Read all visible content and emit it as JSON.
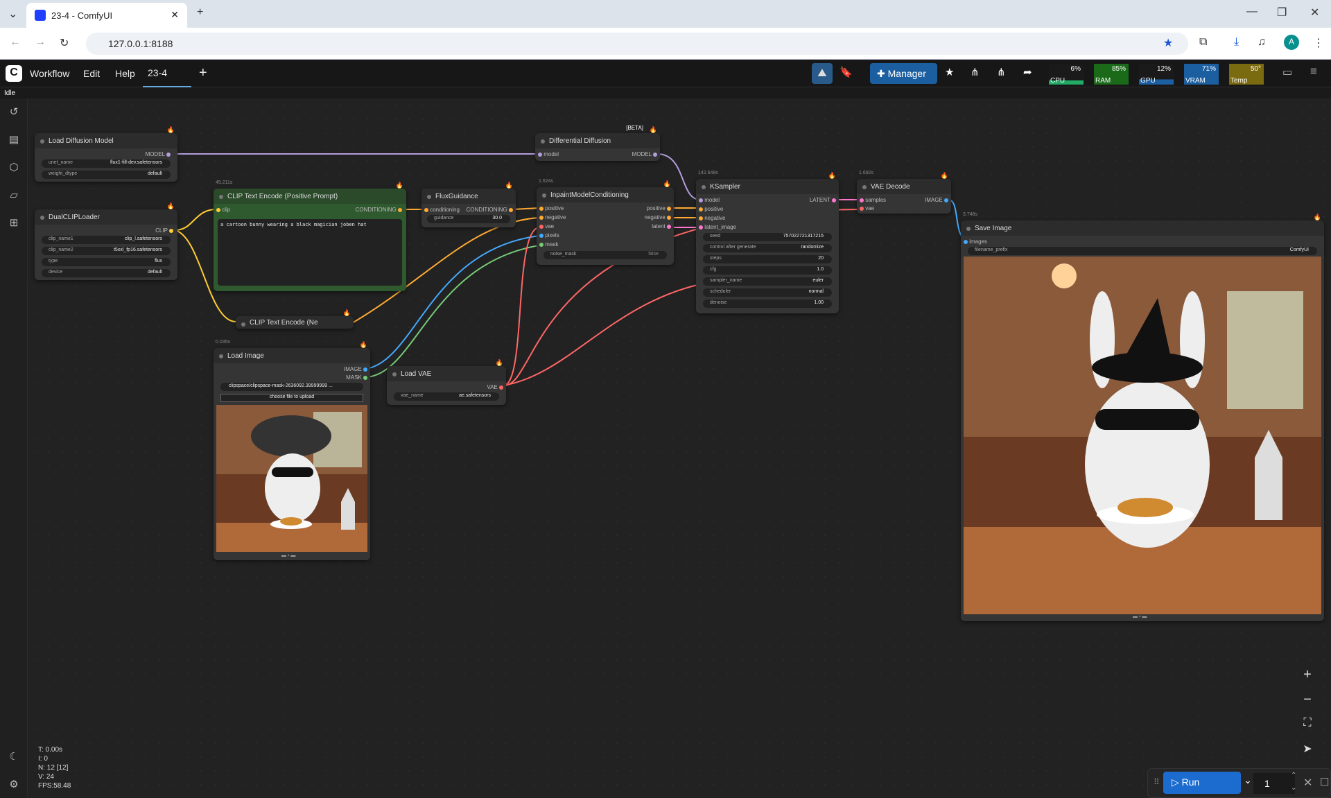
{
  "browser": {
    "tab_title": "23-4 - ComfyUI",
    "url": "127.0.0.1:8188",
    "avatar": "A"
  },
  "menu": {
    "workflow": "Workflow",
    "edit": "Edit",
    "help": "Help",
    "tab": "23-4",
    "manager": "Manager"
  },
  "status": "Idle",
  "perf": {
    "cpu": "CPU",
    "cpu_val": "6%",
    "ram": "RAM",
    "ram_val": "85%",
    "gpu": "GPU",
    "gpu_val": "12%",
    "vram": "VRAM",
    "vram_val": "71%",
    "temp": "Temp",
    "temp_val": "50°"
  },
  "nodes": {
    "load_diffusion": {
      "title": "Load Diffusion Model",
      "out": "MODEL",
      "unet_label": "unet_name",
      "unet": "flux1-fill-dev.safetensors",
      "dtype_label": "weight_dtype",
      "dtype": "default"
    },
    "dualclip": {
      "title": "DualCLIPLoader",
      "out": "CLIP",
      "c1_label": "clip_name1",
      "c1": "clip_l.safetensors",
      "c2_label": "clip_name2",
      "c2": "t5xxl_fp16.safetensors",
      "type_label": "type",
      "type": "flux",
      "device_label": "device",
      "device": "default"
    },
    "clip_pos": {
      "time": "45.211s",
      "title": "CLIP Text Encode (Positive Prompt)",
      "in": "clip",
      "out": "CONDITIONING",
      "text": "a cartoon bunny wearing a black magician joben hat"
    },
    "clip_neg": {
      "title": "CLIP Text Encode (Ne"
    },
    "flux": {
      "title": "FluxGuidance",
      "in": "conditioning",
      "out": "CONDITIONING",
      "g_label": "guidance",
      "g": "30.0"
    },
    "diffdiff": {
      "beta": "[BETA]",
      "title": "Differential Diffusion",
      "in": "model",
      "out": "MODEL"
    },
    "inpaint": {
      "time": "1.624s",
      "title": "InpaintModelConditioning",
      "i1": "positive",
      "i2": "negative",
      "i3": "vae",
      "i4": "pixels",
      "i5": "mask",
      "o1": "positive",
      "o2": "negative",
      "o3": "latent",
      "nm_label": "noise_mask",
      "nm": "false"
    },
    "ksampler": {
      "time": "142.648s",
      "title": "KSampler",
      "i1": "model",
      "i2": "positive",
      "i3": "negative",
      "i4": "latent_image",
      "out": "LATENT",
      "seed_l": "seed",
      "seed": "757022721317215",
      "cag_l": "control after generate",
      "cag": "randomize",
      "steps_l": "steps",
      "steps": "20",
      "cfg_l": "cfg",
      "cfg": "1.0",
      "sampler_l": "sampler_name",
      "sampler": "euler",
      "sched_l": "scheduler",
      "sched": "normal",
      "den_l": "denoise",
      "den": "1.00"
    },
    "vaedecode": {
      "time": "1.692s",
      "title": "VAE Decode",
      "i1": "samples",
      "i2": "vae",
      "out": "IMAGE"
    },
    "saveimg": {
      "time": "3.748s",
      "title": "Save Image",
      "in": "images",
      "fp_label": "filename_prefix",
      "fp": "ComfyUI"
    },
    "loadimg": {
      "time": "0.035s",
      "title": "Load Image",
      "o1": "IMAGE",
      "o2": "MASK",
      "file": "clipspace/clipspace-mask-2636092.39999999 ...",
      "upload": "choose file to upload"
    },
    "loadvae": {
      "title": "Load VAE",
      "out": "VAE",
      "vae_label": "vae_name",
      "vae": "ae.safetensors"
    }
  },
  "run": {
    "label": "Run",
    "count": "1"
  },
  "stats": {
    "t": "T: 0.00s",
    "i": "I: 0",
    "n": "N: 12 [12]",
    "v": "V: 24",
    "fps": "FPS:58.48"
  }
}
